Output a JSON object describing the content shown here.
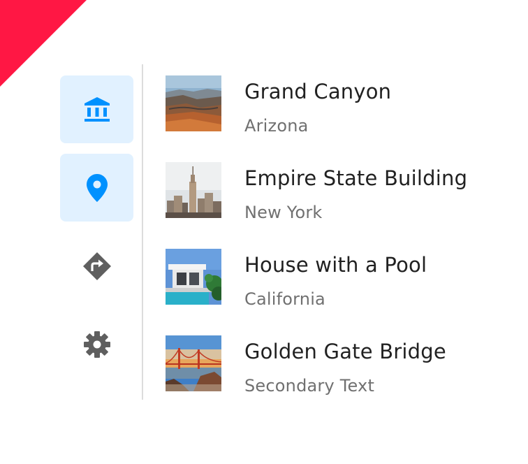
{
  "colors": {
    "accent": "#0091ff",
    "active_bg": "#e1f1ff",
    "ribbon": "#ff1744",
    "icon_inactive": "#5f5f5f",
    "primary_text": "#212121",
    "secondary_text": "#707070"
  },
  "rail": {
    "items": [
      {
        "icon": "bank-icon",
        "active": true
      },
      {
        "icon": "map-pin-icon",
        "active": true
      },
      {
        "icon": "directions-icon",
        "active": false
      },
      {
        "icon": "gear-icon",
        "active": false
      }
    ]
  },
  "list": {
    "items": [
      {
        "title": "Grand Canyon",
        "subtitle": "Arizona",
        "image": "grand-canyon-thumbnail"
      },
      {
        "title": "Empire State Building",
        "subtitle": "New York",
        "image": "empire-state-thumbnail"
      },
      {
        "title": "House with a Pool",
        "subtitle": "California",
        "image": "house-pool-thumbnail"
      },
      {
        "title": "Golden Gate Bridge",
        "subtitle": "Secondary Text",
        "image": "golden-gate-thumbnail"
      }
    ]
  }
}
